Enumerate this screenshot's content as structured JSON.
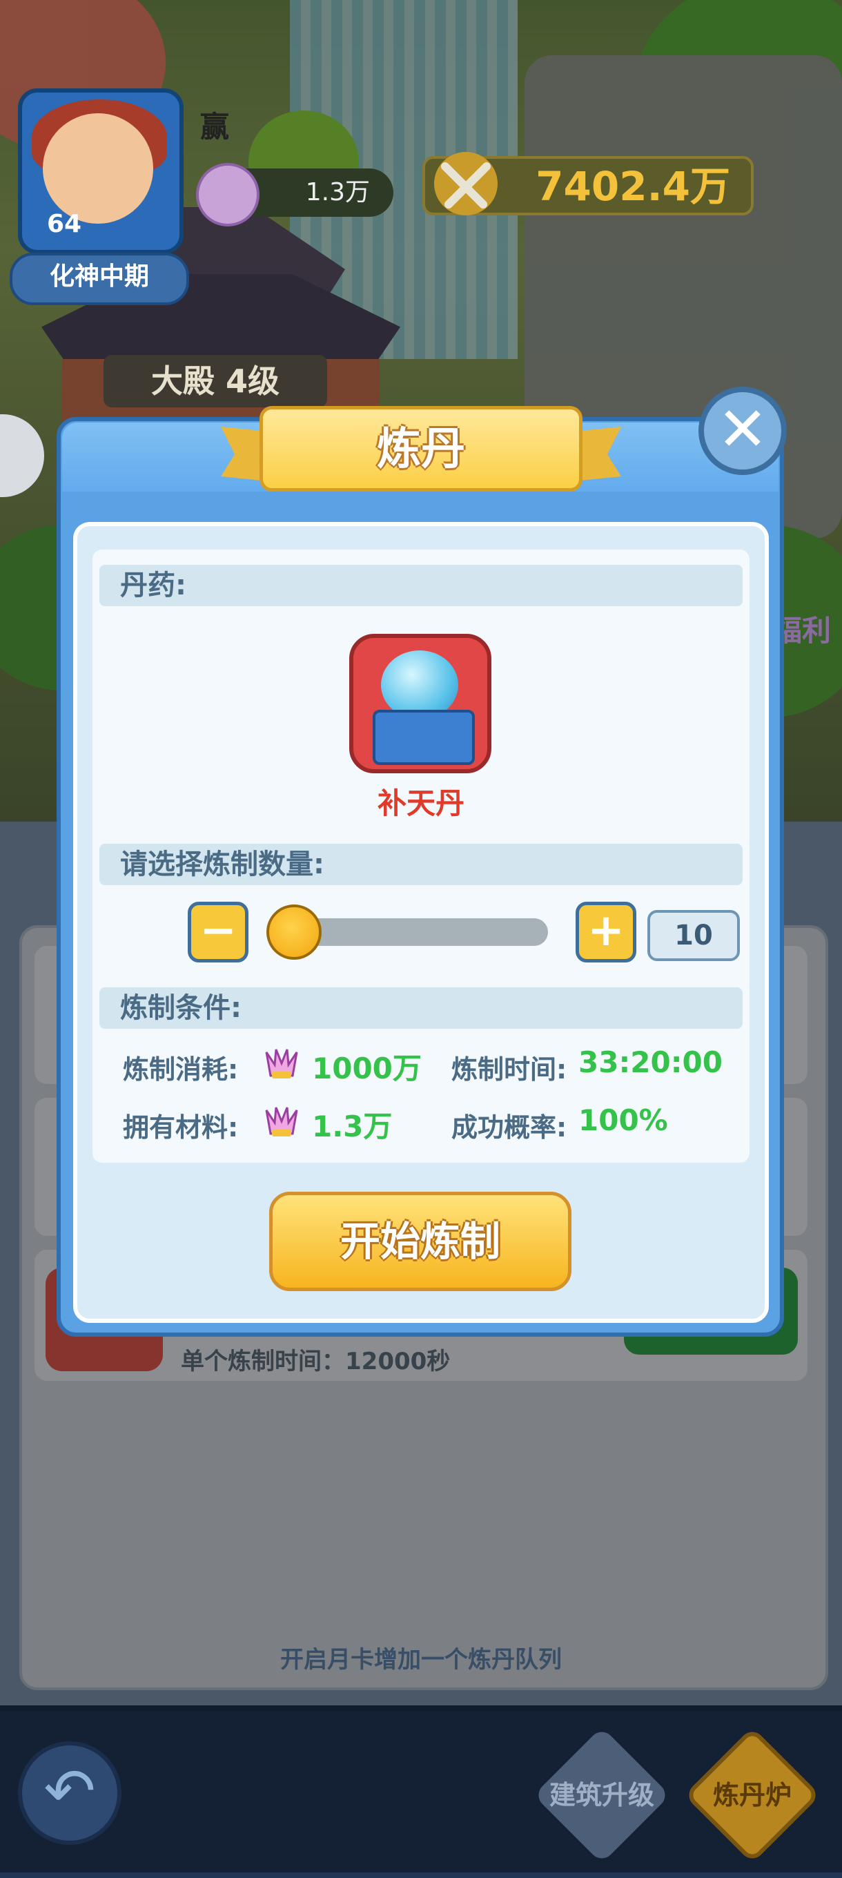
{
  "hud": {
    "player_level": "64",
    "player_name": "赢",
    "realm": "化神中期",
    "resource_amount": "1.3万",
    "combat_power": "7402.4万",
    "building": "大殿 4级",
    "side_label": "福利"
  },
  "dialog": {
    "title": "炼丹",
    "close_icon": "close-icon",
    "pill_section_label": "丹药:",
    "pill_name": "补天丹",
    "quantity_section_label": "请选择炼制数量:",
    "decrement_label": "−",
    "increment_label": "+",
    "quantity_value": "10",
    "slider_fraction": 0.0,
    "conditions_section_label": "炼制条件:",
    "conditions": {
      "cost_label": "炼制消耗:",
      "cost_value": "1000万",
      "time_label": "炼制时间:",
      "time_value": "33:20:00",
      "owned_label": "拥有材料:",
      "owned_value": "1.3万",
      "success_label": "成功概率:",
      "success_value": "100%"
    },
    "start_button_label": "开始炼制"
  },
  "background": {
    "single_time": "单个炼制时间：12000秒",
    "month_card_hint": "开启月卡增加一个炼丹队列"
  },
  "bottom_nav": {
    "back_icon": "back-arrow-icon",
    "upgrade_label": "建筑升级",
    "furnace_label": "炼丹炉"
  },
  "colors": {
    "accent_green": "#34c24a",
    "pill_red": "#e03a2a",
    "gold": "#f7c93a",
    "dialog_blue": "#5aa2e4"
  }
}
